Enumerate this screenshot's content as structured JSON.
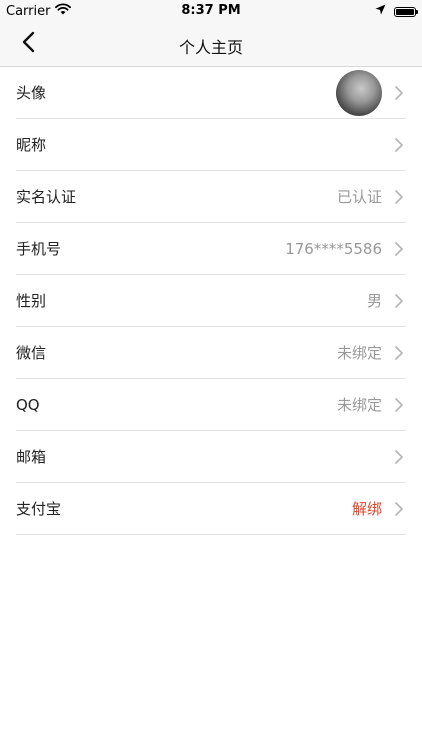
{
  "status_bar": {
    "carrier": "Carrier",
    "time": "8:37 PM",
    "icons": [
      "wifi-icon",
      "location-arrow-icon",
      "battery-icon"
    ]
  },
  "nav": {
    "title": "个人主页",
    "back_icon": "chevron-left-icon"
  },
  "rows": [
    {
      "label": "头像",
      "value": "",
      "type": "avatar"
    },
    {
      "label": "昵称",
      "value": ""
    },
    {
      "label": "实名认证",
      "value": "已认证"
    },
    {
      "label": "手机号",
      "value": "176****5586"
    },
    {
      "label": "性别",
      "value": "男"
    },
    {
      "label": "微信",
      "value": "未绑定"
    },
    {
      "label": "QQ",
      "value": "未绑定"
    },
    {
      "label": "邮箱",
      "value": ""
    },
    {
      "label": "支付宝",
      "value": "解绑",
      "value_color": "#e0452b"
    }
  ],
  "colors": {
    "value_gray": "#999999",
    "accent_red": "#e0452b",
    "nav_bg": "#f7f7f7"
  }
}
